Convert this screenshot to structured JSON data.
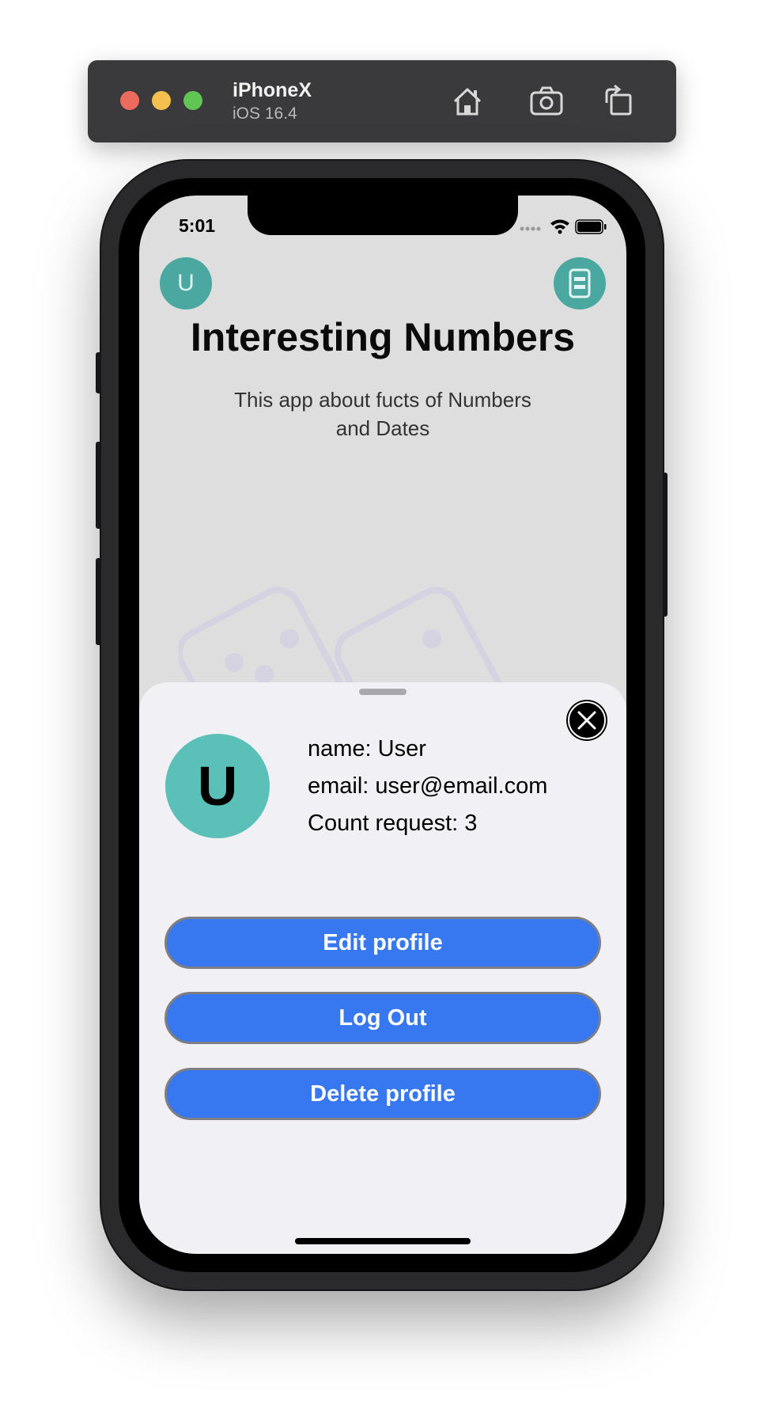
{
  "simulator": {
    "device_name": "iPhoneX",
    "os_version": "iOS 16.4",
    "buttons": [
      "home-icon",
      "screenshot-icon",
      "rotate-icon"
    ]
  },
  "status_bar": {
    "time": "5:01",
    "icons": [
      "cellular-icon",
      "wifi-icon",
      "battery-icon"
    ]
  },
  "header": {
    "avatar_letter": "U",
    "menu_icon": "menu-card-icon",
    "title": "Interesting Numbers",
    "description": "This app about fucts of Numbers and Dates"
  },
  "profile_sheet": {
    "avatar_letter": "U",
    "name_line": "name: User",
    "email_line": "email: user@email.com",
    "count_line": "Count request: 3",
    "buttons": {
      "edit": "Edit profile",
      "logout": "Log Out",
      "delete": "Delete profile"
    }
  },
  "colors": {
    "accent_teal": "#5bc0b7",
    "button_blue": "#3778f0",
    "sheet_bg": "#f1f1f5"
  }
}
